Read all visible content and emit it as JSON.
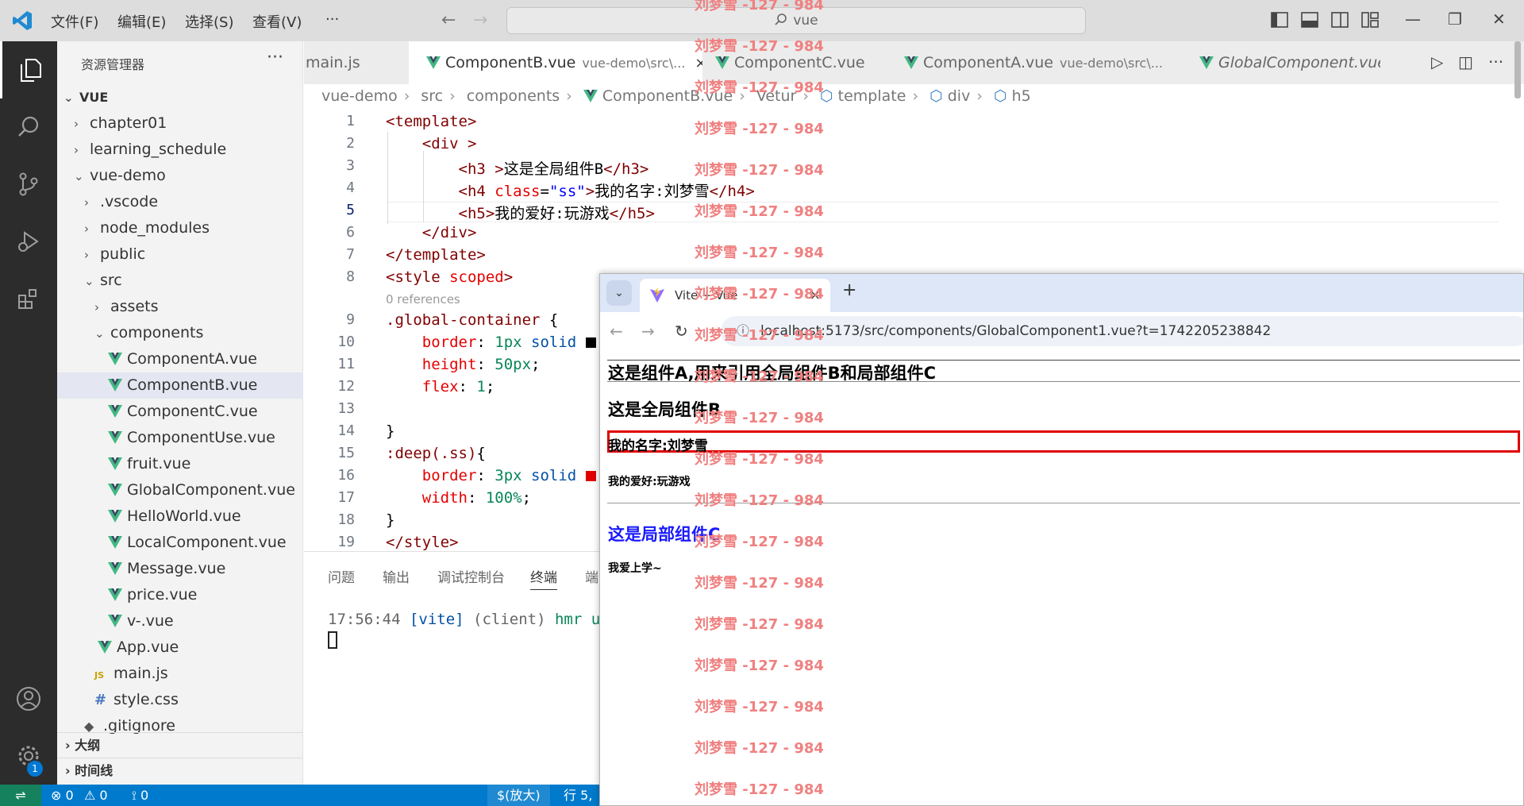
{
  "titlebar": {
    "menu": [
      "文件(F)",
      "编辑(E)",
      "选择(S)",
      "查看(V)",
      "···"
    ],
    "search": "vue"
  },
  "sidebar": {
    "title": "资源管理器",
    "more": "···",
    "root": "VUE",
    "tree": [
      {
        "label": "chapter01",
        "kind": "folder",
        "indent": 1,
        "open": false
      },
      {
        "label": "learning_schedule",
        "kind": "folder",
        "indent": 1,
        "open": false
      },
      {
        "label": "vue-demo",
        "kind": "folder",
        "indent": 1,
        "open": true
      },
      {
        "label": ".vscode",
        "kind": "folder",
        "indent": 2,
        "open": false
      },
      {
        "label": "node_modules",
        "kind": "folder",
        "indent": 2,
        "open": false
      },
      {
        "label": "public",
        "kind": "folder",
        "indent": 2,
        "open": false
      },
      {
        "label": "src",
        "kind": "folder",
        "indent": 2,
        "open": true
      },
      {
        "label": "assets",
        "kind": "folder",
        "indent": 3,
        "open": false
      },
      {
        "label": "components",
        "kind": "folder",
        "indent": 3,
        "open": true
      },
      {
        "label": "ComponentA.vue",
        "kind": "vue",
        "indent": 4
      },
      {
        "label": "ComponentB.vue",
        "kind": "vue",
        "indent": 4,
        "selected": true
      },
      {
        "label": "ComponentC.vue",
        "kind": "vue",
        "indent": 4
      },
      {
        "label": "ComponentUse.vue",
        "kind": "vue",
        "indent": 4
      },
      {
        "label": "fruit.vue",
        "kind": "vue",
        "indent": 4
      },
      {
        "label": "GlobalComponent.vue",
        "kind": "vue",
        "indent": 4
      },
      {
        "label": "HelloWorld.vue",
        "kind": "vue",
        "indent": 4
      },
      {
        "label": "LocalComponent.vue",
        "kind": "vue",
        "indent": 4
      },
      {
        "label": "Message.vue",
        "kind": "vue",
        "indent": 4
      },
      {
        "label": "price.vue",
        "kind": "vue",
        "indent": 4
      },
      {
        "label": "v-.vue",
        "kind": "vue",
        "indent": 4
      },
      {
        "label": "App.vue",
        "kind": "vue",
        "indent": 3
      },
      {
        "label": "main.js",
        "kind": "js",
        "indent": 3
      },
      {
        "label": "style.css",
        "kind": "css",
        "indent": 3
      },
      {
        "label": ".gitignore",
        "kind": "git",
        "indent": 2
      }
    ],
    "js_icon": "JS",
    "css_icon": "#",
    "sections": [
      "大纲",
      "时间线"
    ]
  },
  "tabs": [
    {
      "label": "main.js",
      "path": ""
    },
    {
      "label": "ComponentB.vue",
      "path": "vue-demo\\src\\...",
      "active": true,
      "close": "×"
    },
    {
      "label": "ComponentC.vue",
      "path": ""
    },
    {
      "label": "ComponentA.vue",
      "path": "vue-demo\\src\\..."
    },
    {
      "label": "GlobalComponent.vue",
      "path": "",
      "italic": true
    }
  ],
  "tab_actions": [
    "▷",
    "◫",
    "···"
  ],
  "breadcrumb": [
    "vue-demo",
    "src",
    "components",
    "ComponentB.vue",
    "Vetur",
    "template",
    "div",
    "h5"
  ],
  "editor": {
    "line_numbers": [
      "1",
      "2",
      "3",
      "4",
      "5",
      "6",
      "7",
      "8",
      "",
      "9",
      "10",
      "11",
      "12",
      "13",
      "14",
      "15",
      "16",
      "17",
      "18",
      "19"
    ],
    "current_line": "5",
    "references": "0 references",
    "code": {
      "l1": "<template>",
      "l2": "    <div >",
      "l3_open": "        <h3 >",
      "l3_text": "这是全局组件B",
      "l3_close": "</h3>",
      "l4_open": "        <h4 ",
      "l4_attr": "class",
      "l4_eq": "=",
      "l4_str": "\"ss\"",
      "l4_gt": ">",
      "l4_text": "我的名字:刘梦雪",
      "l4_close": "</h4>",
      "l5_open": "        <h5>",
      "l5_text": "我的爱好:玩游戏",
      "l5_close": "</h5>",
      "l6": "    </div>",
      "l7": "</template>",
      "l8_tag": "<style ",
      "l8_attr": "scoped",
      "l8_gt": ">",
      "l9_sel": ".global-container",
      "l9_brace": " {",
      "l10_prop": "    border",
      "l10_colon": ": ",
      "l10_num": "1px",
      "l10_val": " solid",
      "l11_prop": "    height",
      "l11_colon": ": ",
      "l11_num": "50px",
      "l11_end": ";",
      "l12_prop": "    flex",
      "l12_colon": ": ",
      "l12_num": "1",
      "l12_end": ";",
      "l14": "}",
      "l15_sel": ":deep(.ss)",
      "l15_brace": "{",
      "l16_prop": "    border",
      "l16_colon": ": ",
      "l16_num": "3px",
      "l16_val": " solid",
      "l17_prop": "    width",
      "l17_colon": ": ",
      "l17_num": "100%",
      "l17_end": ";",
      "l18": "}",
      "l19": "</style>"
    }
  },
  "panel": {
    "tabs": [
      "问题",
      "输出",
      "调试控制台",
      "终端",
      "端"
    ],
    "active_tab": "终端",
    "terminal": {
      "time": "17:56:44 ",
      "tag": "[vite]",
      "client": " (client) ",
      "msg": "hmr up"
    }
  },
  "statusbar": {
    "remote": "⇌",
    "errors": "⊗ 0",
    "warnings": "⚠ 0",
    "ports": "⟟ 0",
    "zoom": "$(放大)",
    "cursor": "行 5,"
  },
  "browser": {
    "tab_title": "Vite + Vue",
    "tab_close": "×",
    "new_tab": "+",
    "url": "localhost:5173/src/components/GlobalComponent1.vue?t=1742205238842",
    "page": {
      "component_a": "这是组件A,用来引用全局组件B和局部组件C",
      "global_b_title": "这是全局组件B",
      "name": "我的名字:刘梦雪",
      "hobby": "我的爱好:玩游戏",
      "local_c_title": "这是局部组件C",
      "local_c_text": "我爱上学~"
    },
    "colors": {
      "global_title": "#000000",
      "local_title": "#1a1aff",
      "box_border": "#e00000"
    }
  },
  "watermark": {
    "text": "刘梦雪 -127 - 984",
    "color": "#f08080"
  },
  "colors": {
    "statusbar": "#007acc",
    "activitybar": "#2c2c2c",
    "vue_green": "#41b883"
  }
}
